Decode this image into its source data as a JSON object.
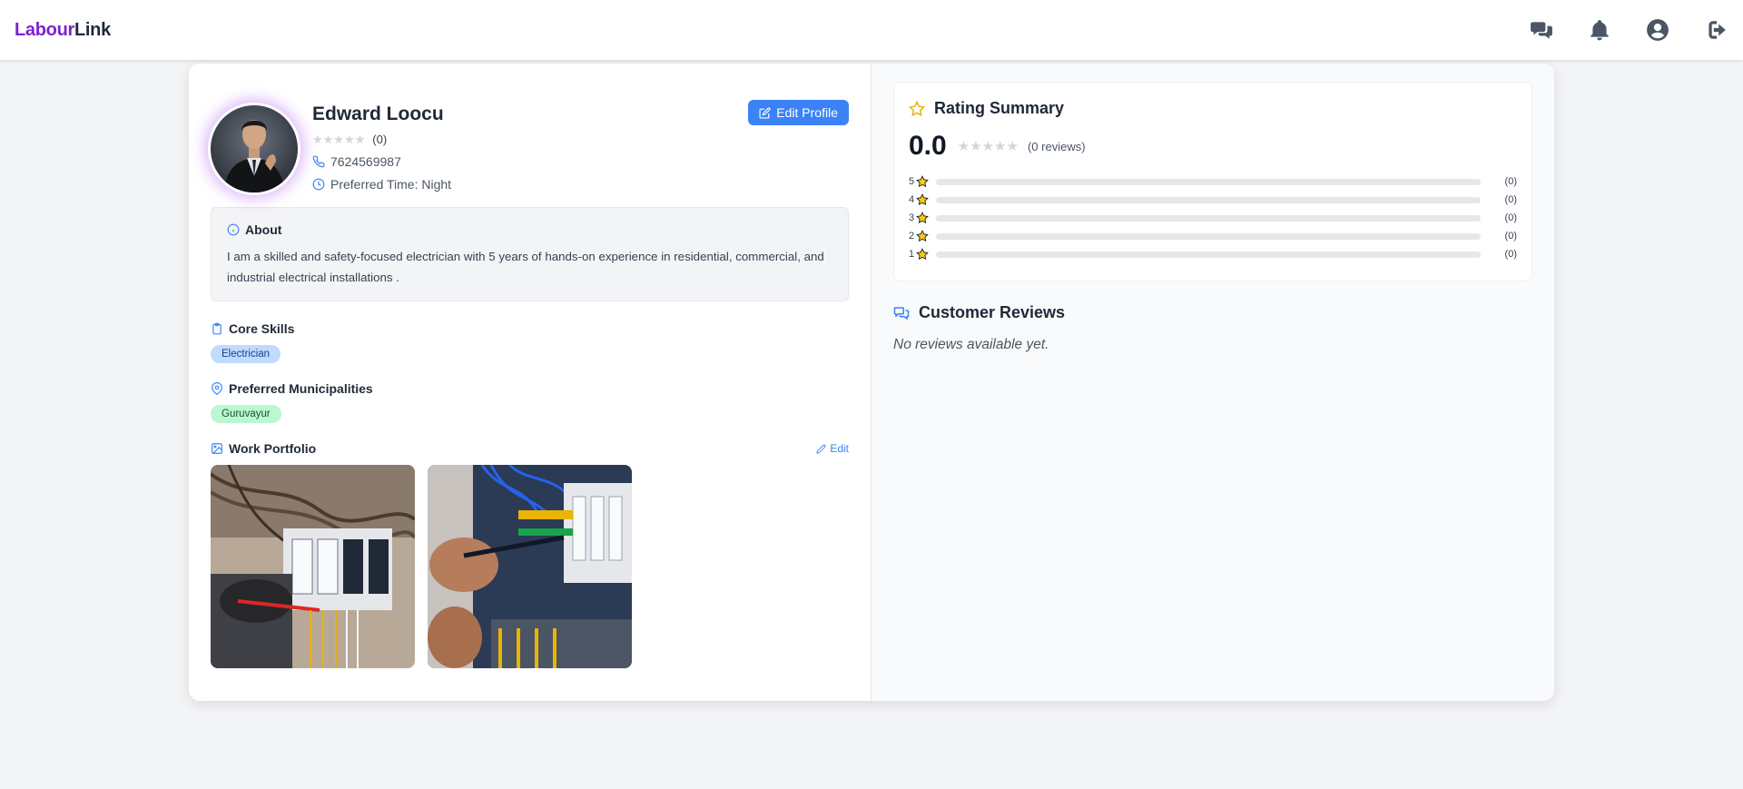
{
  "brand": {
    "part1": "Labour",
    "part2": "Link"
  },
  "nav": {
    "icons": [
      "chat-icon",
      "bell-icon",
      "user-circle-icon",
      "logout-icon"
    ]
  },
  "profile": {
    "name": "Edward Loocu",
    "rating_count": "(0)",
    "rating_stars": 0,
    "phone": "7624569987",
    "preferred_time": "Preferred Time: Night",
    "edit_label": "Edit Profile"
  },
  "about": {
    "title": "About",
    "text": "I am a skilled and safety-focused electrician with 5 years of hands-on experience in residential, commercial, and industrial electrical installations ."
  },
  "skills": {
    "title": "Core Skills",
    "items": [
      "Electrician"
    ]
  },
  "municipalities": {
    "title": "Preferred Municipalities",
    "items": [
      "Guruvayur"
    ]
  },
  "portfolio": {
    "title": "Work Portfolio",
    "edit_label": "Edit",
    "photos": [
      "electrical-panel-wiring-photo",
      "circuit-breaker-screwdriver-photo"
    ]
  },
  "rating_summary": {
    "title": "Rating Summary",
    "score": "0.0",
    "reviews_count": "(0 reviews)",
    "breakdown": [
      {
        "stars": "5",
        "count": "(0)",
        "fraction": 0
      },
      {
        "stars": "4",
        "count": "(0)",
        "fraction": 0
      },
      {
        "stars": "3",
        "count": "(0)",
        "fraction": 0
      },
      {
        "stars": "2",
        "count": "(0)",
        "fraction": 0
      },
      {
        "stars": "1",
        "count": "(0)",
        "fraction": 0
      }
    ]
  },
  "customer_reviews": {
    "title": "Customer Reviews",
    "empty_text": "No reviews available yet."
  },
  "colors": {
    "brand_purple": "#7e22ce",
    "primary_blue": "#3b82f6",
    "star_yellow": "#eab308",
    "skill_tag": "#bfdbfe",
    "area_tag": "#bbf7d0"
  }
}
